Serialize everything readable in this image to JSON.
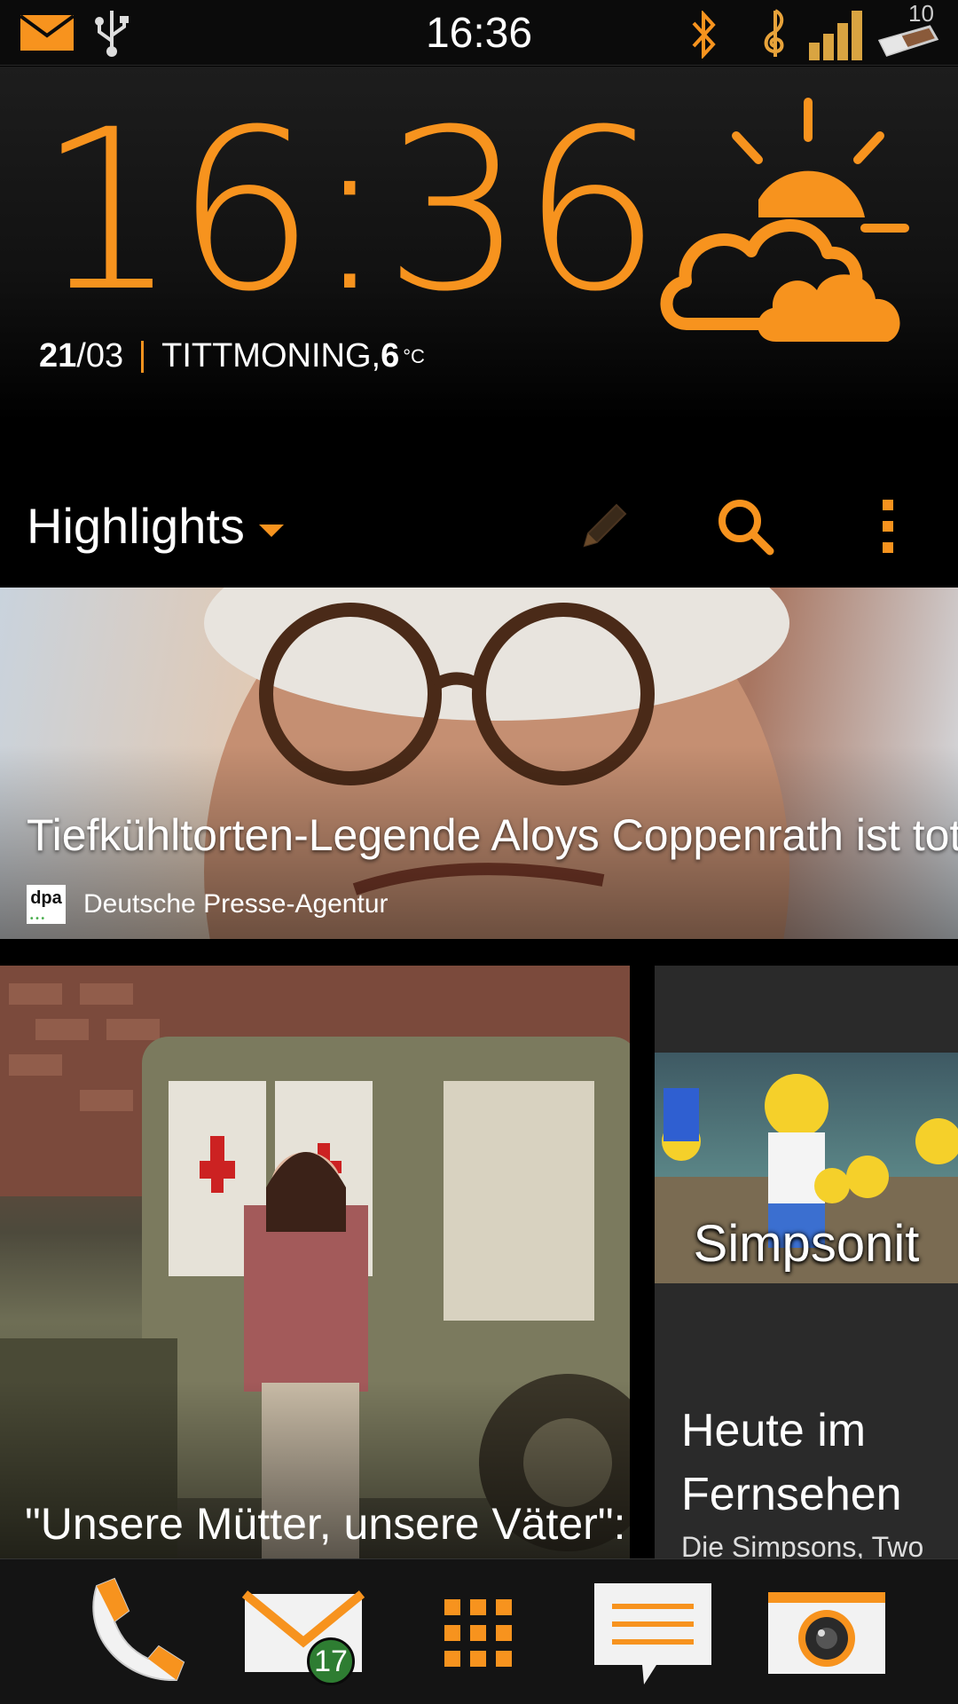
{
  "status_bar": {
    "time": "16:36",
    "left_icons": [
      "mail-icon",
      "usb-icon"
    ],
    "right_icons": [
      "bluetooth-icon",
      "music-note-icon",
      "volume-icon",
      "battery-icon"
    ],
    "battery_number": "10",
    "accent_color": "#f7931e"
  },
  "clock_widget": {
    "time": "16:36",
    "date_day": "21",
    "date_month": "/03",
    "location": "TITTMONING, ",
    "temperature": "6",
    "temperature_unit": "°C",
    "weather_icon": "partly-cloudy-icon"
  },
  "highlights": {
    "title": "Highlights",
    "edit_icon": "pencil-icon",
    "search_icon": "search-icon",
    "menu_icon": "overflow-menu-icon"
  },
  "cards": {
    "top": {
      "headline": "Tiefkühltorten-Legende Aloys Coppenrath ist tot",
      "source_logo": "dpa",
      "source": "Deutsche Presse-Agentur"
    },
    "left": {
      "title": "\"Unsere Mütter, unsere Väter\":"
    },
    "right": {
      "thumb_label": "Simpsonit",
      "title": "Heute im Fernsehen",
      "subtitle": "Die Simpsons, Two"
    }
  },
  "dock": {
    "items": [
      "phone-icon",
      "mail-icon",
      "app-drawer-icon",
      "messages-icon",
      "camera-icon"
    ],
    "mail_badge": "17"
  }
}
